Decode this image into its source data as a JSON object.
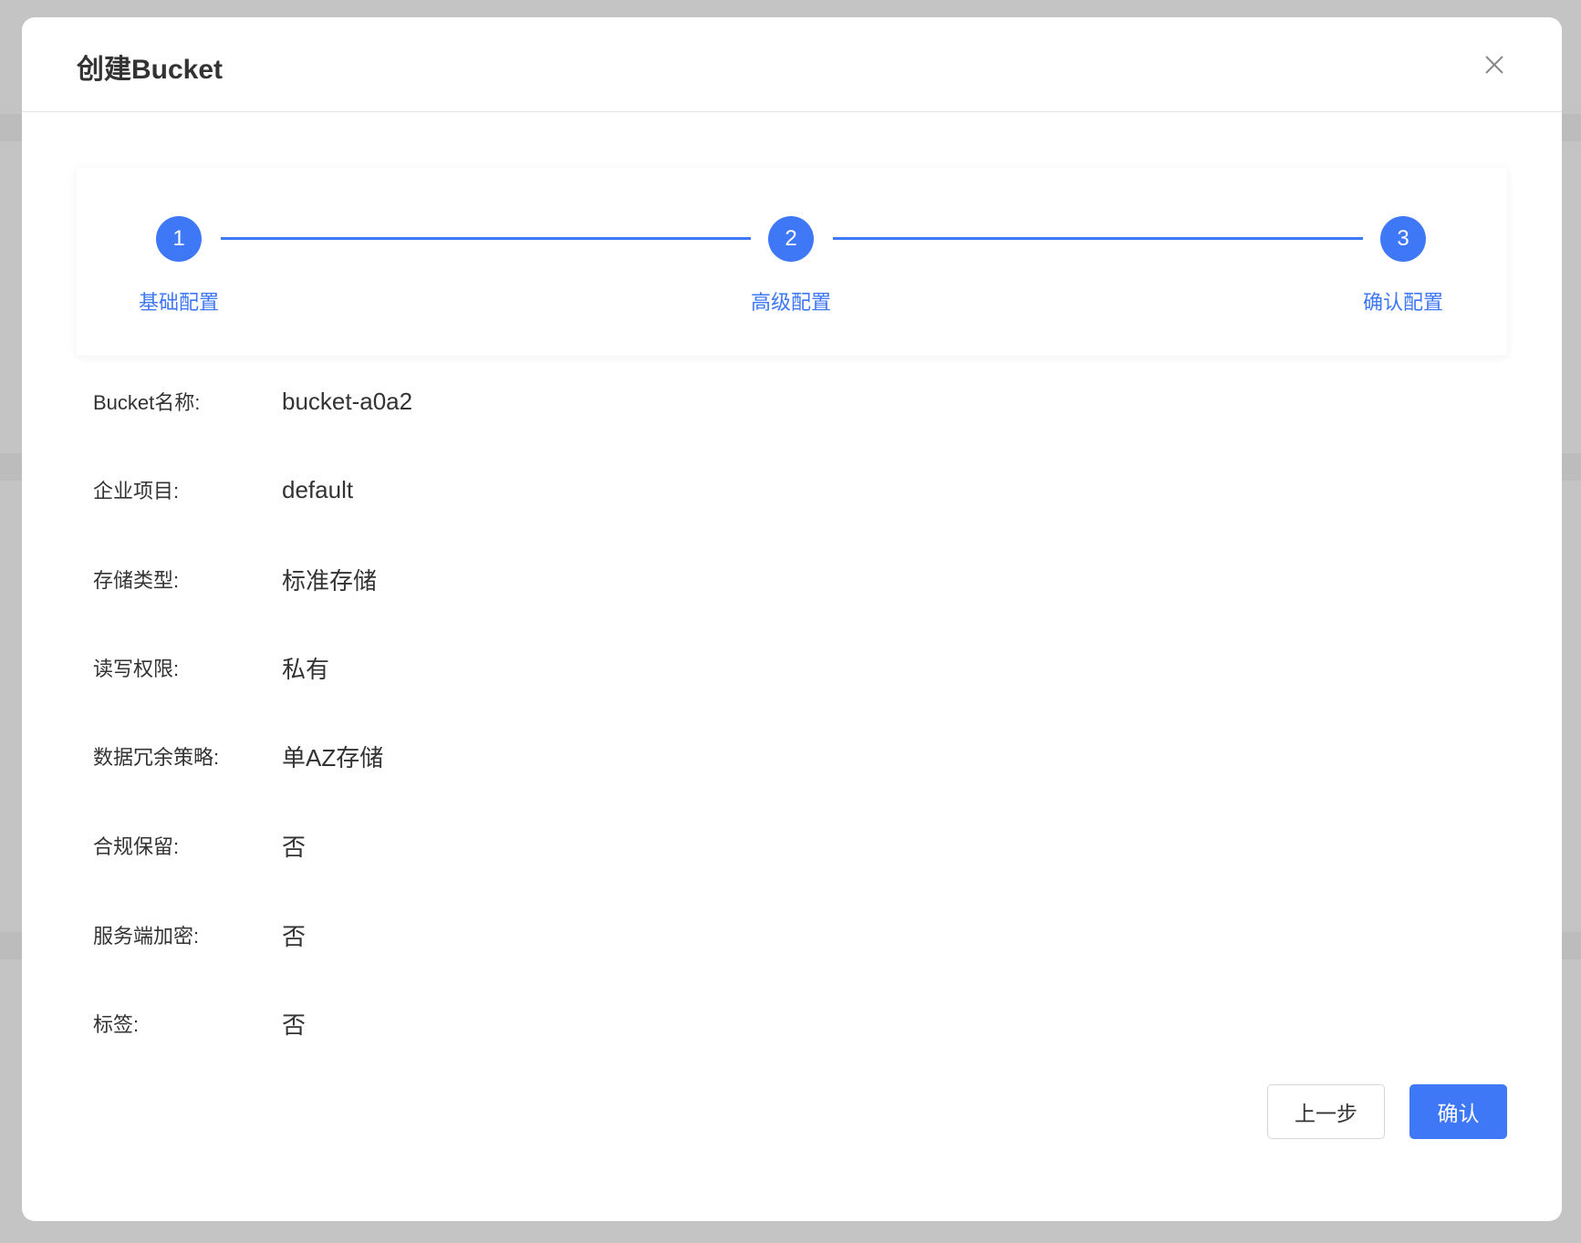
{
  "dialog": {
    "title": "创建Bucket",
    "close_icon": "close-icon"
  },
  "steps": [
    {
      "number": "1",
      "label": "基础配置"
    },
    {
      "number": "2",
      "label": "高级配置"
    },
    {
      "number": "3",
      "label": "确认配置"
    }
  ],
  "fields": [
    {
      "label": "Bucket名称:",
      "value": "bucket-a0a2"
    },
    {
      "label": "企业项目:",
      "value": "default"
    },
    {
      "label": "存储类型:",
      "value": "标准存储"
    },
    {
      "label": "读写权限:",
      "value": "私有"
    },
    {
      "label": "数据冗余策略:",
      "value": "单AZ存储"
    },
    {
      "label": "合规保留:",
      "value": "否"
    },
    {
      "label": "服务端加密:",
      "value": "否"
    },
    {
      "label": "标签:",
      "value": "否"
    }
  ],
  "buttons": {
    "prev": "上一步",
    "confirm": "确认"
  },
  "colors": {
    "accent": "#3f78f6"
  }
}
